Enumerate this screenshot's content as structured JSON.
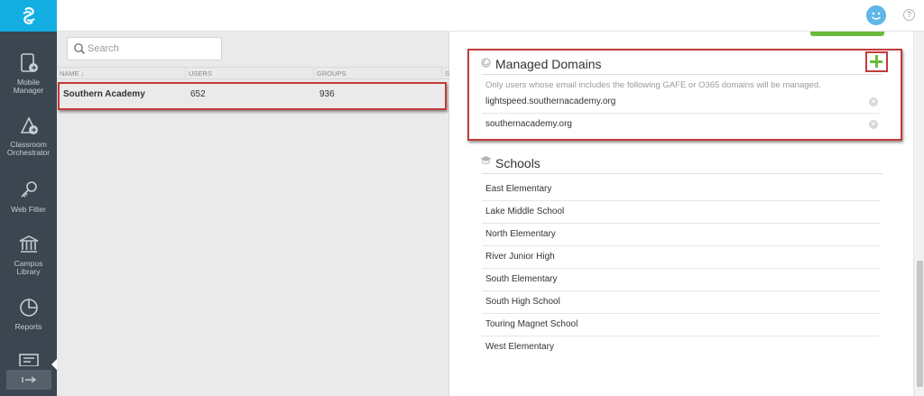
{
  "sidebar": {
    "items": [
      {
        "label": "Mobile\nManager",
        "icon": "mobile-manager-icon"
      },
      {
        "label": "Classroom\nOrchestrator",
        "icon": "classroom-orchestrator-icon"
      },
      {
        "label": "Web Filter",
        "icon": "web-filter-icon"
      },
      {
        "label": "Campus\nLibrary",
        "icon": "campus-library-icon"
      },
      {
        "label": "Reports",
        "icon": "reports-icon"
      }
    ]
  },
  "search": {
    "placeholder": "Search"
  },
  "table": {
    "columns": [
      "NAME ↓",
      "USERS",
      "GROUPS",
      "S"
    ],
    "rows": [
      {
        "name": "Southern Academy",
        "users": "652",
        "groups": "936"
      }
    ]
  },
  "managed_domains": {
    "title": "Managed Domains",
    "note": "Only users whose email includes the following GAFE or O365 domains will be managed.",
    "domains": [
      "lightspeed.southernacademy.org",
      "southernacademy.org"
    ]
  },
  "schools": {
    "title": "Schools",
    "items": [
      "East Elementary",
      "Lake Middle School",
      "North Elementary",
      "River Junior High",
      "South Elementary",
      "South High School",
      "Touring Magnet School",
      "West Elementary"
    ]
  },
  "colors": {
    "accent": "#12aee2",
    "highlight": "#c23b3b",
    "add": "#6cbb3c",
    "sidebar": "#3b4650"
  }
}
